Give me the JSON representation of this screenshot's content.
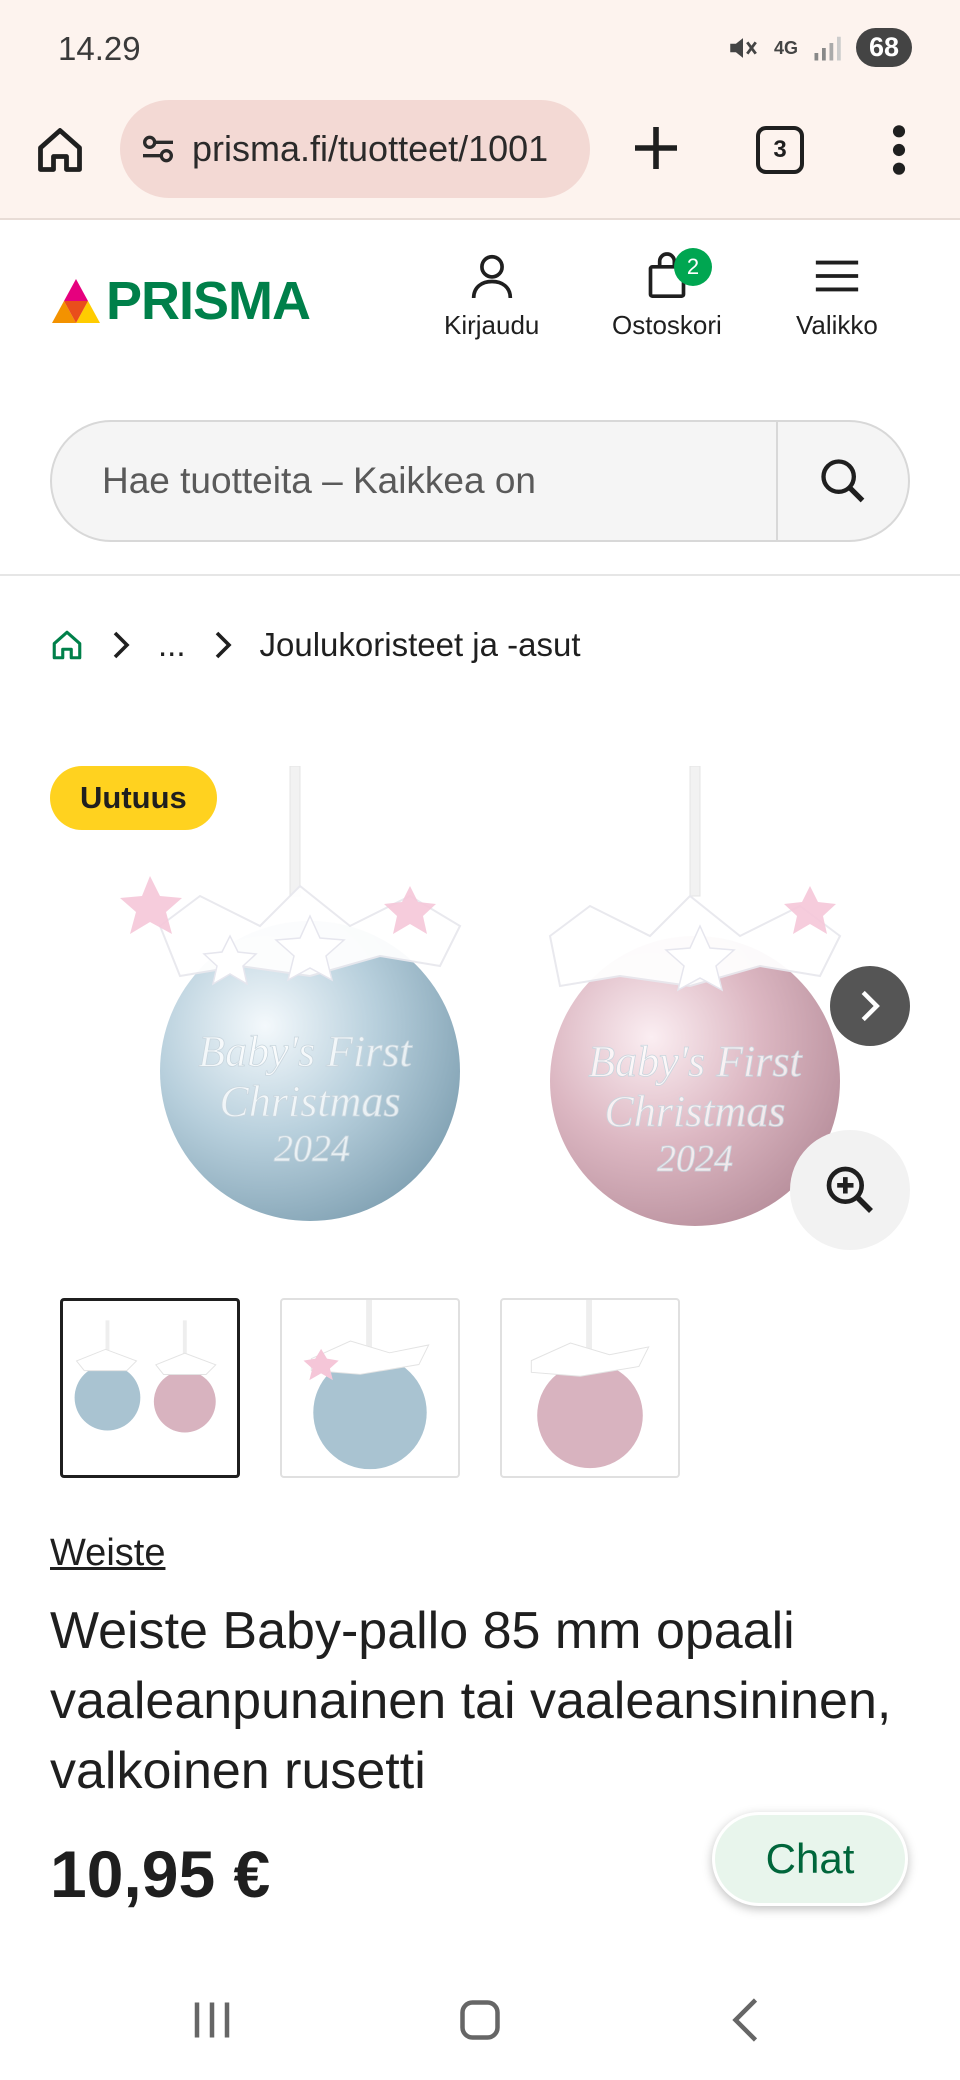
{
  "status_bar": {
    "time": "14.29",
    "battery": "68",
    "network": "4G"
  },
  "browser": {
    "url": "prisma.fi/tuotteet/1001",
    "tab_count": "3"
  },
  "site": {
    "logo_text": "PRISMA",
    "login_label": "Kirjaudu",
    "cart_label": "Ostoskori",
    "cart_count": "2",
    "menu_label": "Valikko",
    "search_placeholder": "Hae tuotteita – Kaikkea on"
  },
  "breadcrumb": {
    "ellipsis": "...",
    "current": "Joulukoristeet ja -asut"
  },
  "gallery": {
    "badge": "Uutuus",
    "ornament_text_line1": "Baby's First",
    "ornament_text_line2": "Christmas",
    "ornament_text_line3": "2024",
    "thumbnail_count": 3,
    "active_thumbnail": 1
  },
  "product": {
    "brand": "Weiste",
    "title": "Weiste Baby-pallo 85 mm opaali vaaleanpunainen tai vaaleansininen, valkoinen rusetti",
    "price": "10,95 €"
  },
  "chat": {
    "label": "Chat"
  },
  "colors": {
    "brand_green": "#00804a",
    "badge_yellow": "#ffd21f",
    "cart_badge": "#00a651",
    "browser_bg": "#fdf3ee",
    "url_bg": "#f3d9d4"
  }
}
